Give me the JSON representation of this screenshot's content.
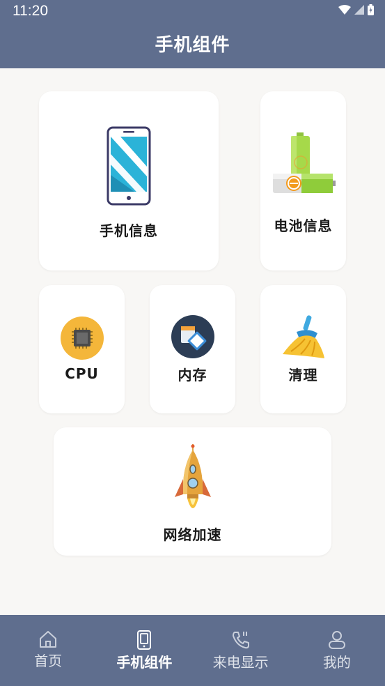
{
  "status_bar": {
    "time": "11:20"
  },
  "header": {
    "title": "手机组件"
  },
  "cards": {
    "phone_info": {
      "label": "手机信息",
      "icon": "smartphone-icon"
    },
    "battery_info": {
      "label": "电池信息",
      "icon": "battery-icon"
    },
    "cpu": {
      "label": "CPU",
      "icon": "cpu-chip-icon"
    },
    "memory": {
      "label": "内存",
      "icon": "memory-card-icon"
    },
    "clean": {
      "label": "清理",
      "icon": "broom-icon"
    },
    "network_boost": {
      "label": "网络加速",
      "icon": "rocket-icon"
    }
  },
  "bottom_nav": {
    "items": [
      {
        "label": "首页",
        "icon": "home-icon",
        "active": false
      },
      {
        "label": "手机组件",
        "icon": "phone-icon",
        "active": true
      },
      {
        "label": "来电显示",
        "icon": "incoming-call-icon",
        "active": false
      },
      {
        "label": "我的",
        "icon": "user-icon",
        "active": false
      }
    ]
  },
  "colors": {
    "header_bg": "#5f6e8e",
    "page_bg": "#f8f7f5",
    "card_bg": "#ffffff"
  }
}
